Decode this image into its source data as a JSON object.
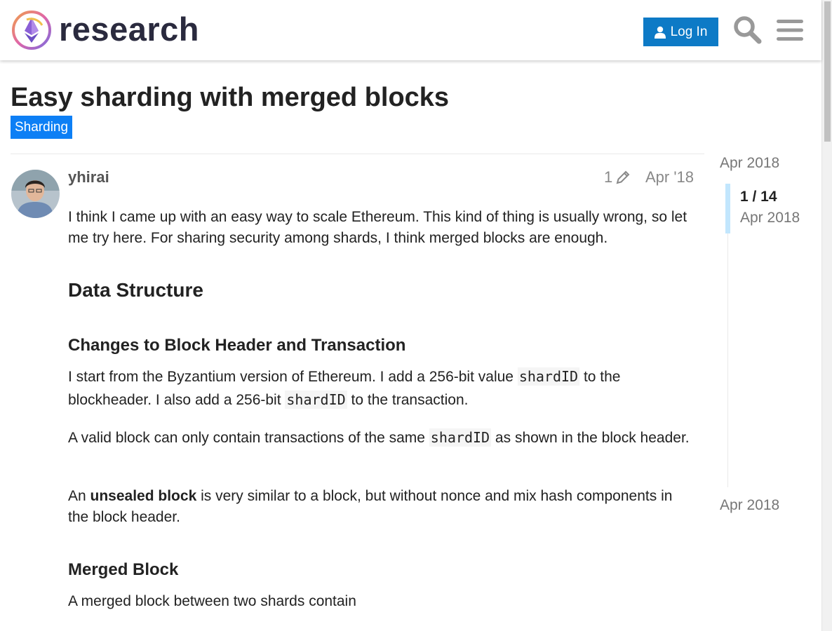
{
  "site": {
    "name": "research",
    "login_label": "Log In"
  },
  "topic": {
    "title": "Easy sharding with merged blocks",
    "category": "Sharding"
  },
  "post": {
    "username": "yhirai",
    "edit_count": "1",
    "date": "Apr '18",
    "p1": "I think I came up with an easy way to scale Ethereum. This kind of thing is usually wrong, so let me try here. For sharing security among shards, I think merged blocks are enough.",
    "h_data_structure": "Data Structure",
    "h_changes": "Changes to Block Header and Transaction",
    "p2_a": "I start from the Byzantium version of Ethereum. I add a 256-bit value ",
    "p2_code1": "shardID",
    "p2_b": " to the blockheader. I also add a 256-bit ",
    "p2_code2": "shardID",
    "p2_c": " to the transaction.",
    "p3_a": "A valid block can only contain transactions of the same ",
    "p3_code": "shardID",
    "p3_b": " as shown in the block header.",
    "p4_a": "An ",
    "p4_bold": "unsealed block",
    "p4_b": " is very similar to a block, but without nonce and mix hash components in the block header.",
    "h_merged": "Merged Block",
    "p5": "A merged block between two shards contain"
  },
  "timeline": {
    "start_date": "Apr 2018",
    "position": "1 / 14",
    "position_date": "Apr 2018",
    "end_date": "Apr 2018"
  },
  "colors": {
    "accent": "#0d7ac6",
    "category": "#0d7ff5",
    "timeline_handle": "#c2e6fd"
  }
}
